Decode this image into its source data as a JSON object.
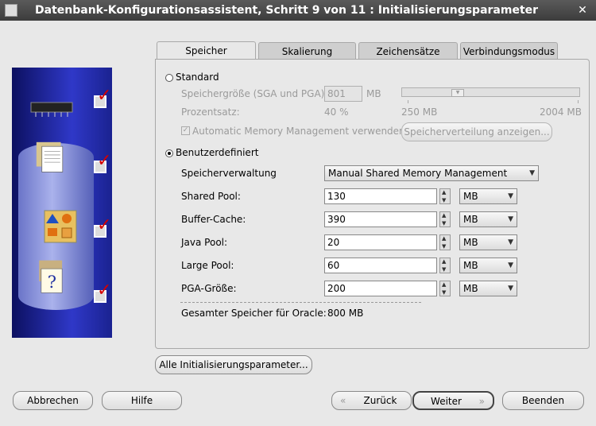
{
  "window": {
    "title": "Datenbank-Konfigurationsassistent, Schritt 9 von 11 : Initialisierungsparameter",
    "close_glyph": "✕"
  },
  "tabs": [
    "Speicher",
    "Skalierung",
    "Zeichensätze",
    "Verbindungsmodus"
  ],
  "standard": {
    "label": "Standard",
    "size_label": "Speichergröße (SGA und PGA):",
    "size_value": "801",
    "size_unit": "MB",
    "percent_label": "Prozentsatz:",
    "percent_value": "40 %",
    "slider_min": "250 MB",
    "slider_max": "2004 MB",
    "amm_label": "Automatic Memory Management verwenden",
    "distribution_button": "Speicherverteilung anzeigen..."
  },
  "custom": {
    "label": "Benutzerdefiniert",
    "mgmt_label": "Speicherverwaltung",
    "mgmt_value": "Manual Shared Memory Management",
    "rows": [
      {
        "label": "Shared Pool:",
        "value": "130",
        "unit": "MB"
      },
      {
        "label": "Buffer-Cache:",
        "value": "390",
        "unit": "MB"
      },
      {
        "label": "Java Pool:",
        "value": "20",
        "unit": "MB"
      },
      {
        "label": "Large Pool:",
        "value": "60",
        "unit": "MB"
      },
      {
        "label": "PGA-Größe:",
        "value": "200",
        "unit": "MB"
      }
    ],
    "total_label": "Gesamter Speicher für Oracle:",
    "total_value": "800 MB"
  },
  "all_params_button": "Alle Initialisierungsparameter...",
  "footer": {
    "cancel": "Abbrechen",
    "help": "Hilfe",
    "back": "Zurück",
    "next": "Weiter",
    "finish": "Beenden"
  },
  "colors": {
    "accent_check": "#d40000",
    "side_panel": "#2f38c8"
  }
}
